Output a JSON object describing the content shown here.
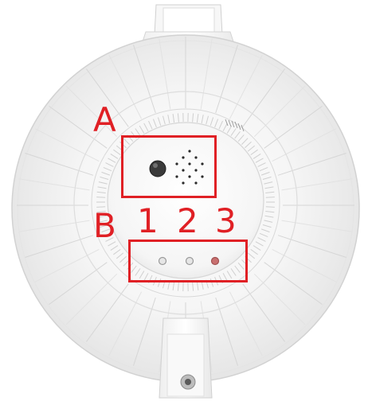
{
  "callouts": {
    "a_label": "A",
    "b_label": "B",
    "led_1_label": "1",
    "led_2_label": "2",
    "led_3_label": "3"
  },
  "colors": {
    "annotation_red": "#e02025",
    "led_1_white": "#e6e6e6",
    "led_2_white": "#e6e6e6",
    "led_3_red": "#c87070",
    "housing_white": "#f4f4f4"
  },
  "icons": {
    "button": "reset-button-icon",
    "vent": "vent-holes-icon",
    "leds": "led-indicator-icon",
    "port": "bottom-port-icon"
  }
}
